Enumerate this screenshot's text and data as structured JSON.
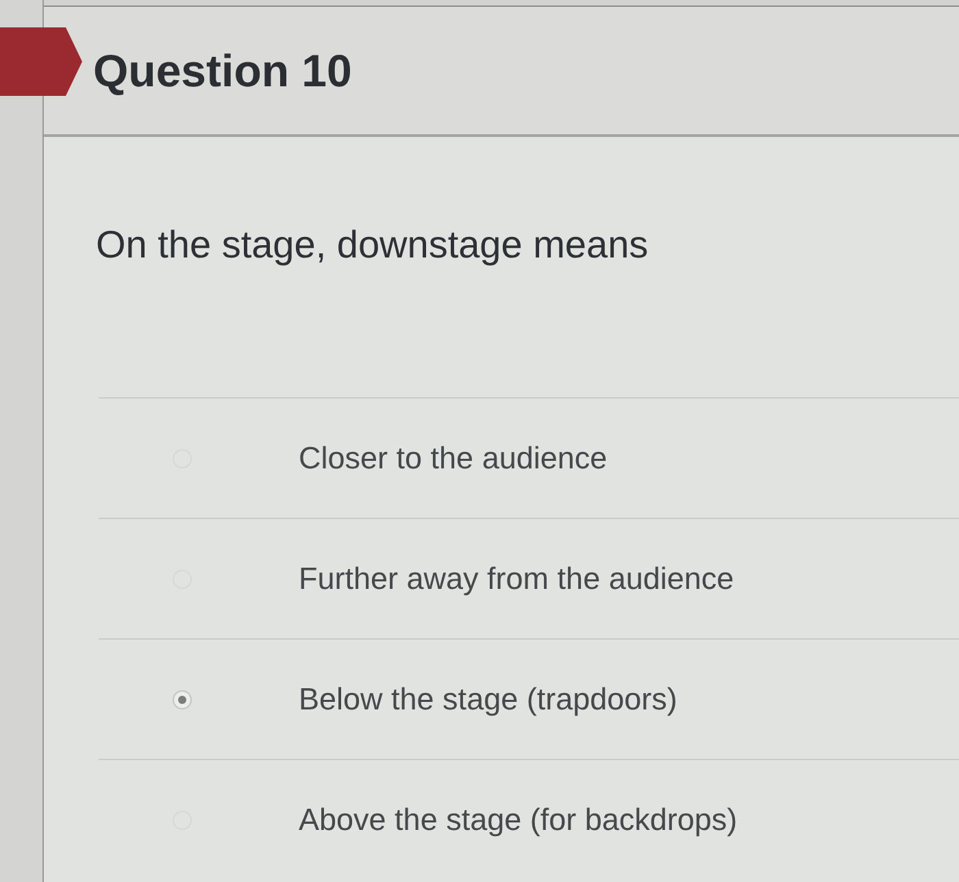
{
  "question": {
    "title": "Question 10",
    "prompt": "On the stage, downstage means"
  },
  "answers": [
    {
      "label": "Closer to the audience",
      "selected": false
    },
    {
      "label": "Further away from the audience",
      "selected": false
    },
    {
      "label": "Below the stage (trapdoors)",
      "selected": true
    },
    {
      "label": "Above the stage (for backdrops)",
      "selected": false
    }
  ]
}
